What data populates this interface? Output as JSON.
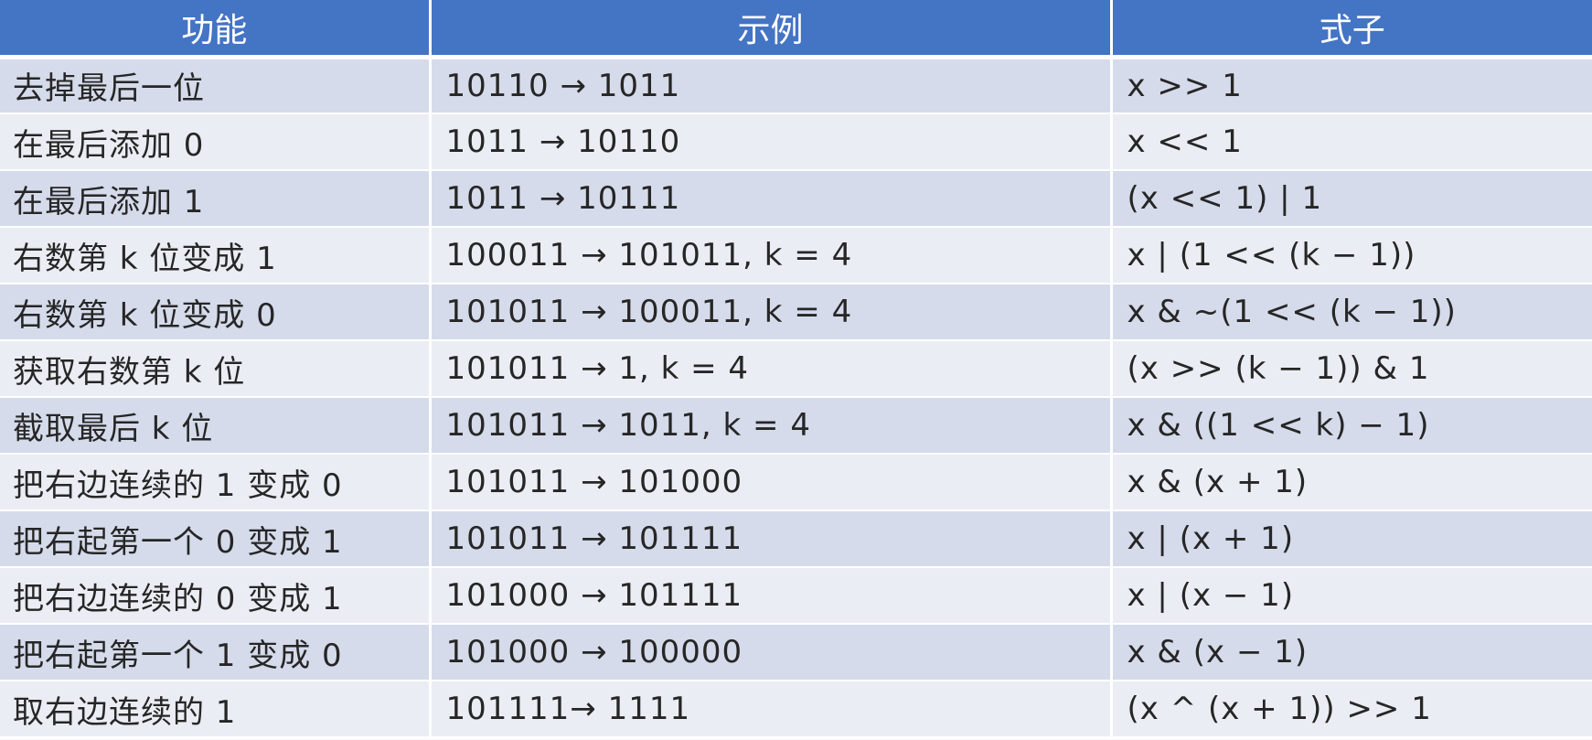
{
  "table": {
    "headers": [
      "功能",
      "示例",
      "式子"
    ],
    "rows": [
      [
        "去掉最后一位",
        "10110 → 1011",
        "x >> 1"
      ],
      [
        "在最后添加 0",
        "1011 → 10110",
        "x << 1"
      ],
      [
        "在最后添加 1",
        "1011 → 10111",
        "(x << 1) | 1"
      ],
      [
        "右数第 k 位变成 1",
        "100011 → 101011, k = 4",
        "x | (1 << (k − 1))"
      ],
      [
        "右数第 k 位变成 0",
        "101011 → 100011, k = 4",
        "x & ~(1 << (k − 1))"
      ],
      [
        "获取右数第 k 位",
        "101011 → 1, k = 4",
        "(x >> (k − 1)) & 1"
      ],
      [
        "截取最后 k 位",
        "101011 → 1011, k = 4",
        "x & ((1 << k) − 1)"
      ],
      [
        "把右边连续的 1 变成 0",
        "101011 → 101000",
        "x & (x + 1)"
      ],
      [
        "把右起第一个 0 变成 1",
        "101011 → 101111",
        "x | (x + 1)"
      ],
      [
        "把右边连续的 0 变成 1",
        "101000 → 101111",
        "x | (x − 1)"
      ],
      [
        "把右起第一个 1 变成 0",
        "101000 → 100000",
        "x & (x − 1)"
      ],
      [
        "取右边连续的 1",
        "101111→ 1111",
        "(x ^ (x + 1)) >> 1"
      ]
    ]
  },
  "colors": {
    "header_bg": "#4474c4",
    "row_dark": "#d5dbea",
    "row_light": "#ebedf4"
  }
}
